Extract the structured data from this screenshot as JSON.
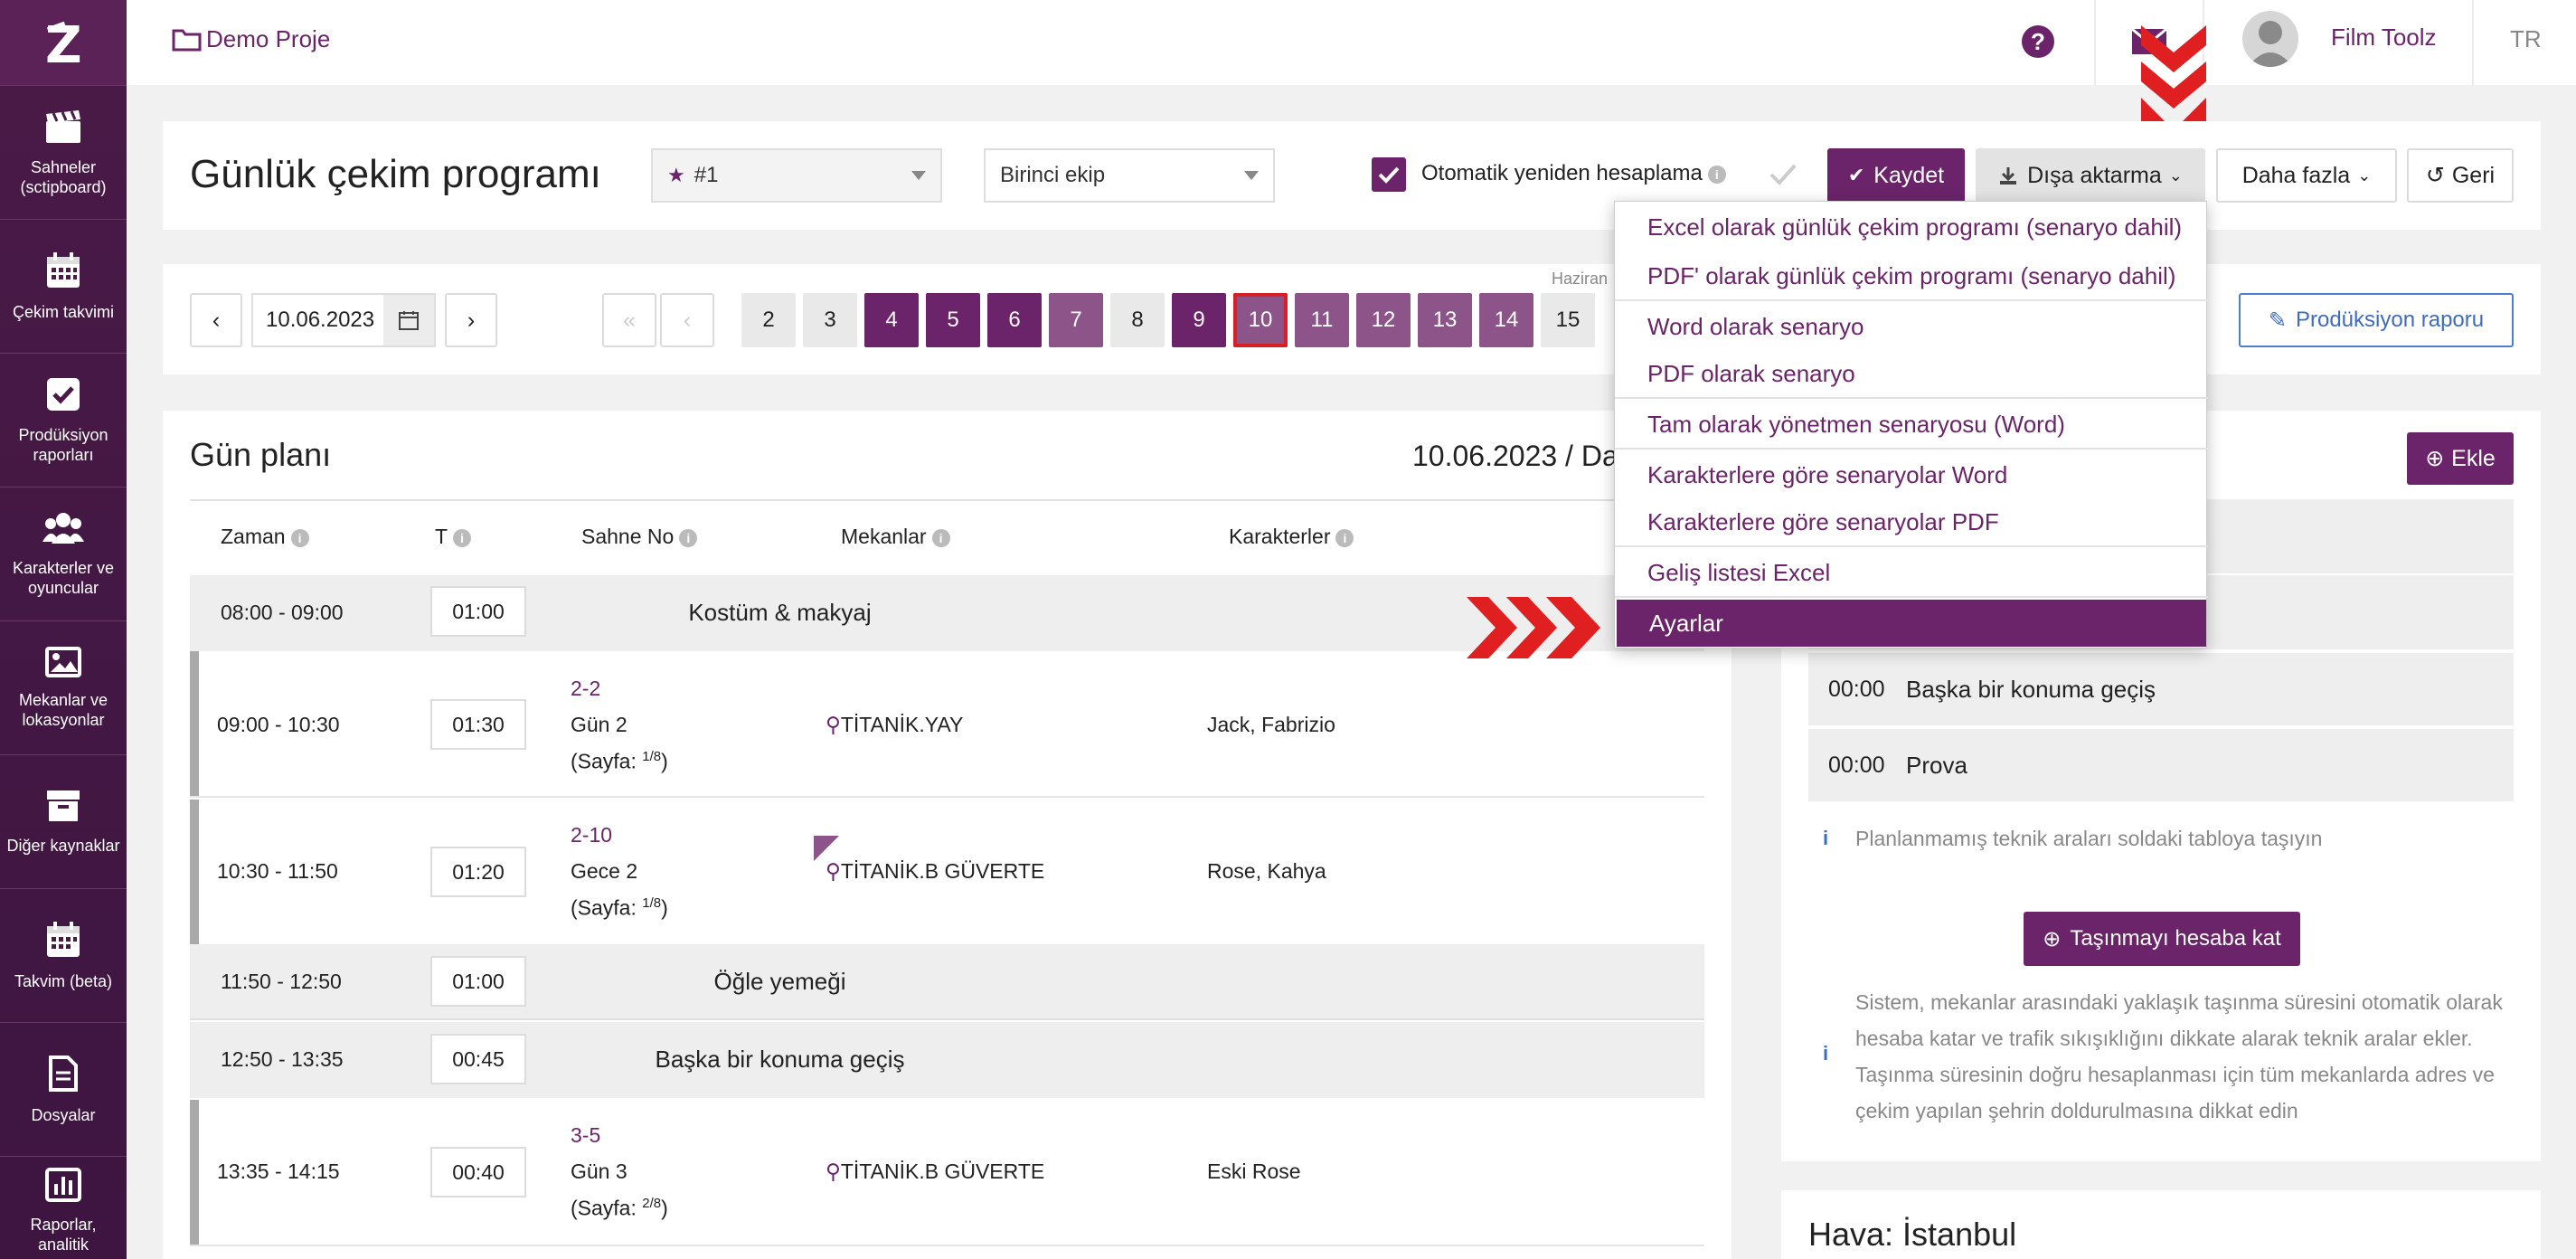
{
  "sidebar": {
    "logo": "Z",
    "items": [
      {
        "icon": "clapperboard-icon",
        "label": "Sahneler (sctipboard)"
      },
      {
        "icon": "calendar-icon",
        "label": "Çekim takvimi"
      },
      {
        "icon": "checkbox-icon",
        "label": "Prodüksiyon raporları"
      },
      {
        "icon": "people-icon",
        "label": "Karakterler ve oyuncular"
      },
      {
        "icon": "image-icon",
        "label": "Mekanlar ve lokasyonlar"
      },
      {
        "icon": "archive-icon",
        "label": "Diğer kaynaklar"
      },
      {
        "icon": "calendar-icon",
        "label": "Takvim (beta)"
      },
      {
        "icon": "document-icon",
        "label": "Dosyalar"
      },
      {
        "icon": "chart-icon",
        "label": "Raporlar, analitik"
      }
    ]
  },
  "topbar": {
    "project": "Demo Proje",
    "user": "Film Toolz",
    "lang": "TR"
  },
  "header": {
    "title": "Günlük çekim programı",
    "schedule_select": "#1",
    "crew_select": "Birinci ekip",
    "auto_recalc_label": "Otomatik yeniden hesaplama",
    "auto_recalc_checked": true,
    "save": "Kaydet",
    "export": "Dışa aktarma",
    "more": "Daha fazla",
    "back": "Geri"
  },
  "datebar": {
    "date": "10.06.2023",
    "prev": "‹",
    "next": "›",
    "first": "«",
    "prev_page": "‹",
    "month_label": "Haziran",
    "days": [
      {
        "n": "2",
        "style": "plain"
      },
      {
        "n": "3",
        "style": "plain"
      },
      {
        "n": "4",
        "style": "dark"
      },
      {
        "n": "5",
        "style": "dark"
      },
      {
        "n": "6",
        "style": "dark"
      },
      {
        "n": "7",
        "style": "mid"
      },
      {
        "n": "8",
        "style": "plain"
      },
      {
        "n": "9",
        "style": "dark"
      },
      {
        "n": "10",
        "style": "sel"
      },
      {
        "n": "11",
        "style": "mid"
      },
      {
        "n": "12",
        "style": "mid"
      },
      {
        "n": "13",
        "style": "mid"
      },
      {
        "n": "14",
        "style": "mid"
      },
      {
        "n": "15",
        "style": "plain"
      }
    ],
    "production_report": "Prodüksiyon raporu"
  },
  "plan": {
    "title": "Gün planı",
    "date_heading": "10.06.2023 / Da",
    "columns": {
      "time": "Zaman",
      "t": "T",
      "scene": "Sahne No",
      "location": "Mekanlar",
      "characters": "Karakterler"
    },
    "rows": [
      {
        "time": "08:00 - 09:00",
        "t": "01:00",
        "label": "Kostüm & makyaj"
      },
      {
        "time": "09:00 - 10:30",
        "t": "01:30",
        "scene": "2-2",
        "scene_sub": "Gün 2",
        "page": "(Sayfa: ",
        "page_frac": "1/8",
        "page_close": ")",
        "location": "TİTANİK.YAY",
        "characters": "Jack, Fabrizio"
      },
      {
        "time": "10:30 - 11:50",
        "t": "01:20",
        "scene": "2-10",
        "scene_sub": "Gece 2",
        "page": "(Sayfa: ",
        "page_frac": "1/8",
        "page_close": ")",
        "location": "TİTANİK.B GÜVERTE",
        "characters": "Rose, Kahya"
      },
      {
        "time": "11:50 - 12:50",
        "t": "01:00",
        "label": "Öğle yemeği"
      },
      {
        "time": "12:50 - 13:35",
        "t": "00:45",
        "label": "Başka bir konuma geçiş"
      },
      {
        "time": "13:35 - 14:15",
        "t": "00:40",
        "scene": "3-5",
        "scene_sub": "Gün 3",
        "page": "(Sayfa: ",
        "page_frac": "2/8",
        "page_close": ")",
        "location": "TİTANİK.B GÜVERTE",
        "characters": "Eski Rose"
      }
    ]
  },
  "right_panel": {
    "add": "Ekle",
    "breaks": [
      {
        "t": "00:00",
        "label": "Başka bir konuma geçiş"
      },
      {
        "t": "00:00",
        "label": "Prova"
      }
    ],
    "hint": "Planlanmamış teknik araları soldaki tabloya taşıyın",
    "transfer_button": "Taşınmayı hesaba kat",
    "info": "Sistem, mekanlar arasındaki yaklaşık taşınma süresini otomatik olarak hesaba katar ve trafik sıkışıklığını dikkate alarak teknik aralar ekler. Taşınma süresinin doğru hesaplanması için tüm mekanlarda adres ve çekim yapılan şehrin doldurulmasına dikkat edin",
    "weather_title": "Hava: İstanbul"
  },
  "export_menu": {
    "items": [
      "Excel olarak günlük çekim programı (senaryo dahil)",
      "PDF' olarak günlük çekim programı (senaryo dahil)",
      "Word olarak senaryo",
      "PDF olarak senaryo",
      "Tam olarak yönetmen senaryosu (Word)",
      "Karakterlere göre senaryolar Word",
      "Karakterlere göre senaryolar PDF",
      "Geliş listesi Excel",
      "Ayarlar"
    ],
    "active": "Ayarlar"
  },
  "colors": {
    "brand": "#6b2469",
    "accent_red": "#e02020"
  }
}
